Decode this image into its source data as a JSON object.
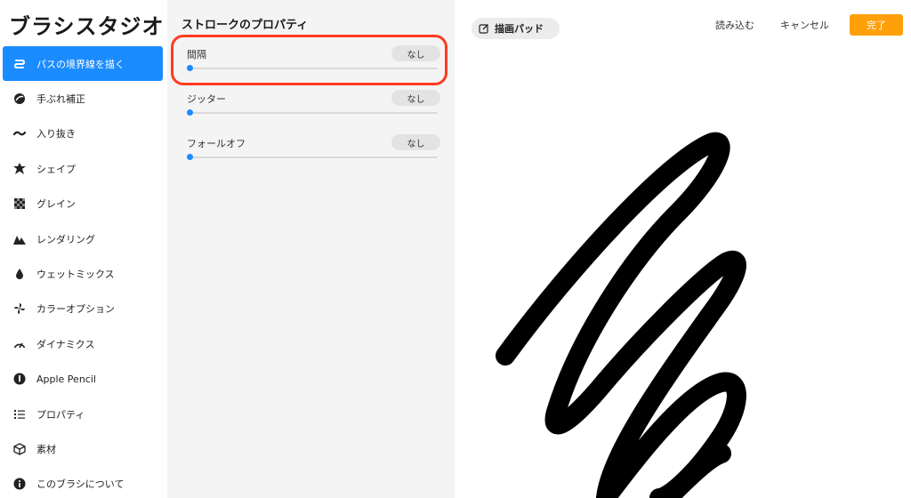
{
  "app": {
    "title": "ブラシスタジオ"
  },
  "sidebar": {
    "items": [
      {
        "label": "パスの境界線を描く",
        "icon": "stroke-path-icon"
      },
      {
        "label": "手ぶれ補正",
        "icon": "stabilization-icon"
      },
      {
        "label": "入り抜き",
        "icon": "taper-icon"
      },
      {
        "label": "シェイプ",
        "icon": "shape-icon"
      },
      {
        "label": "グレイン",
        "icon": "grain-icon"
      },
      {
        "label": "レンダリング",
        "icon": "rendering-icon"
      },
      {
        "label": "ウェットミックス",
        "icon": "wet-mix-icon"
      },
      {
        "label": "カラーオプション",
        "icon": "color-dynamics-icon"
      },
      {
        "label": "ダイナミクス",
        "icon": "dynamics-icon"
      },
      {
        "label": "Apple Pencil",
        "icon": "apple-pencil-icon"
      },
      {
        "label": "プロパティ",
        "icon": "properties-icon"
      },
      {
        "label": "素材",
        "icon": "materials-icon"
      },
      {
        "label": "このブラシについて",
        "icon": "about-icon"
      }
    ],
    "active_index": 0
  },
  "properties": {
    "title": "ストロークのプロパティ",
    "rows": [
      {
        "label": "間隔",
        "value": "なし",
        "level": 0
      },
      {
        "label": "ジッター",
        "value": "なし",
        "level": 0
      },
      {
        "label": "フォールオフ",
        "value": "なし",
        "level": 0
      }
    ]
  },
  "canvas": {
    "pad_label": "描画パッド",
    "import_label": "読み込む",
    "cancel_label": "キャンセル",
    "done_label": "完了"
  },
  "colors": {
    "accent": "#1a8cff",
    "done": "#ff9f0a",
    "highlight": "#ff3b1f"
  }
}
